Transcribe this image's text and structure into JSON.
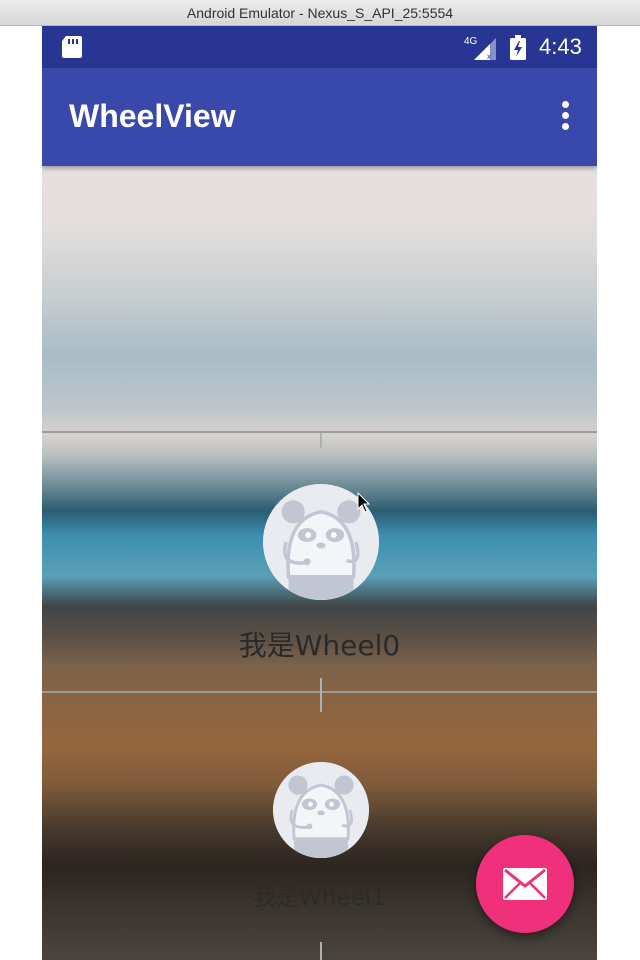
{
  "window": {
    "title": "Android Emulator - Nexus_S_API_25:5554"
  },
  "status_bar": {
    "time": "4:43",
    "network": "4G",
    "icons": [
      "sd-card-icon",
      "signal-4g-icon",
      "battery-charging-icon"
    ]
  },
  "app_bar": {
    "title": "WheelView",
    "menu_icon": "more-vert-icon"
  },
  "wheel": {
    "items": [
      {
        "label": "我是Wheel0",
        "icon": "panda-avatar-icon"
      },
      {
        "label": "我是Wheel1",
        "icon": "panda-avatar-icon"
      }
    ]
  },
  "fab": {
    "icon": "email-icon"
  },
  "colors": {
    "status_bar": "#283593",
    "app_bar": "#3949ab",
    "fab": "#f0307a"
  }
}
